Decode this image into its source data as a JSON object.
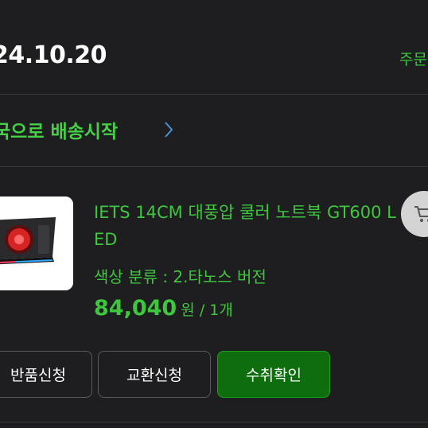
{
  "order": {
    "date": "24.10.20",
    "detail_link": "주문"
  },
  "shipping": {
    "status_text": "국으로 배송시작"
  },
  "product": {
    "name": "IETS 14CM 대풍압 쿨러 노트북 GT600 LED",
    "option": "색상 분류 : 2.타노스 버전",
    "price": "84,040",
    "unit_qty": "원 / 1개"
  },
  "actions": {
    "return_label": "반품신청",
    "exchange_label": "교환신청",
    "confirm_label": "수취확인"
  },
  "colors": {
    "background": "#1e1e20",
    "accent_green": "#3fc63f",
    "confirm_button_bg": "#0e6e0e",
    "divider": "#3a3a3c"
  },
  "icons": {
    "cart": "cart-icon",
    "chevron": "chevron-right-icon"
  }
}
